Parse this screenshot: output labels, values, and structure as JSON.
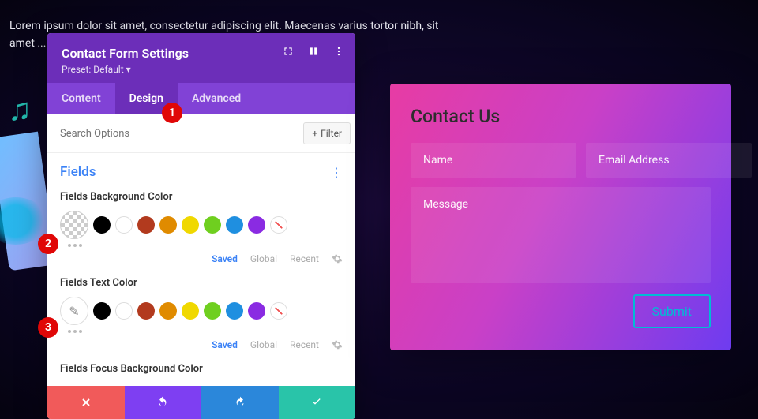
{
  "bg_text": "Lorem ipsum dolor sit amet, consectetur adipiscing elit. Maecenas varius tortor nibh, sit amet ... quam hendrerit",
  "panel": {
    "title": "Contact Form Settings",
    "preset": "Preset: Default ▾",
    "tabs": [
      "Content",
      "Design",
      "Advanced"
    ],
    "active_tab": 1,
    "search_placeholder": "Search Options",
    "filter_label": "Filter",
    "section": "Fields",
    "fields": [
      {
        "label": "Fields Background Color",
        "picker_type": "checker"
      },
      {
        "label": "Fields Text Color",
        "picker_type": "eyedrop"
      },
      {
        "label": "Fields Focus Background Color"
      }
    ],
    "swatch_colors": [
      "#000000",
      "#ffffff",
      "#b23a1e",
      "#e08b00",
      "#f0d800",
      "#6fcf1f",
      "#1f8fe0",
      "#8a2be2"
    ],
    "meta": {
      "saved": "Saved",
      "global": "Global",
      "recent": "Recent"
    }
  },
  "badges": [
    "1",
    "2",
    "3"
  ],
  "card": {
    "title": "Contact Us",
    "name_ph": "Name",
    "email_ph": "Email Address",
    "msg_ph": "Message",
    "submit": "Submit"
  }
}
